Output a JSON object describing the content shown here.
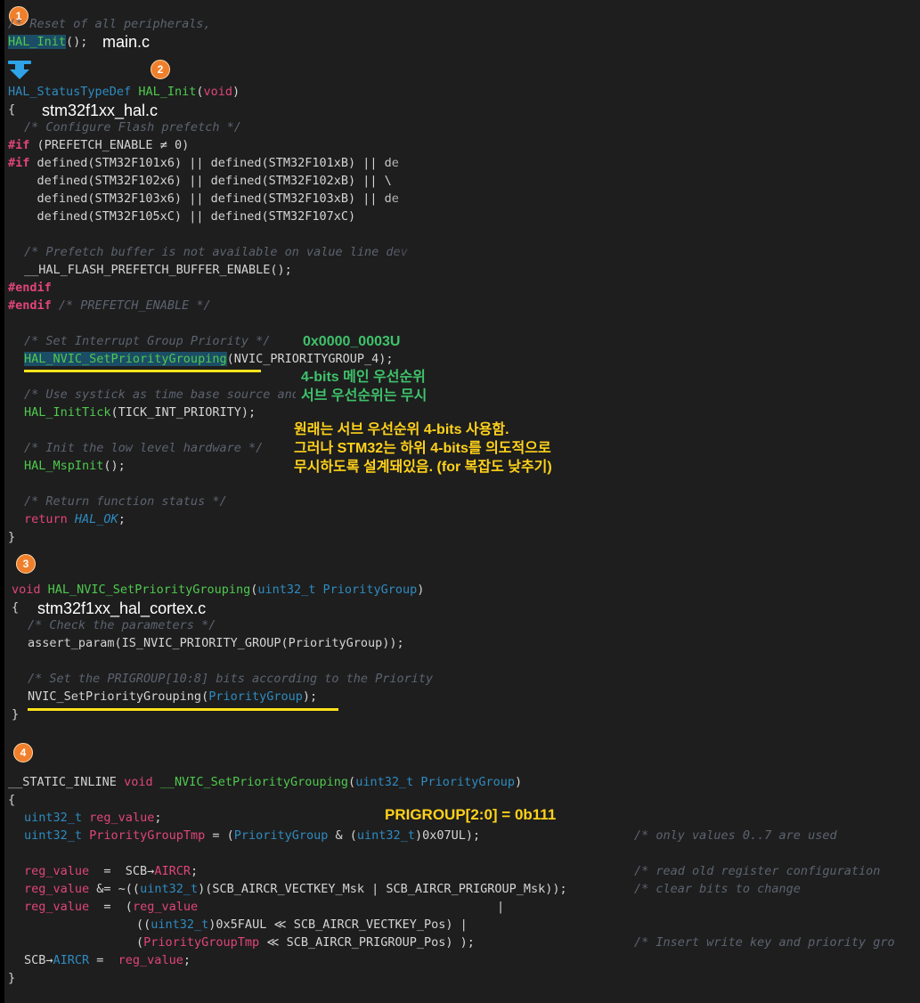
{
  "badges": [
    "1",
    "2",
    "3",
    "4"
  ],
  "files": {
    "main": "main.c",
    "hal": "stm32f1xx_hal.c",
    "cortex": "stm32f1xx_hal_cortex.c"
  },
  "annotations": {
    "group_value": "0x0000_0003U",
    "main_priority": "4-bits 메인 우선순위",
    "sub_priority": "서브 우선순위는 무시",
    "explain_1": "원래는 서브 우선순위 4-bits 사용함.",
    "explain_2": "그러나 STM32는 하위 4-bits를 의도적으로",
    "explain_3": "무시하도록 설계돼있음. (for 복잡도 낮추기)",
    "prigroup": "PRIGROUP[2:0] = 0b111"
  },
  "code": {
    "b1_comment": "/* Reset of all peripherals,",
    "hal_init_call": "HAL_Init",
    "hal_init_call_rest": "();",
    "hal_statustype": "HAL_StatusTypeDef",
    "hal_init_name": "HAL_Init",
    "void_kw": "void",
    "open_paren": "(",
    "close_paren": ")",
    "open_brace": "{",
    "close_brace": "}",
    "c_prefetch": "/* Configure Flash prefetch */",
    "if_kw": "#if",
    "if1_rest": " (PREFETCH_ENABLE ≠ 0)",
    "if2_rest": " defined(STM32F101x6) || defined(STM32F101xB) || de",
    "cont1": "    defined(STM32F102x6) || defined(STM32F102xB) || \\",
    "cont2": "    defined(STM32F103x6) || defined(STM32F103xB) || de",
    "cont3": "    defined(STM32F105xC) || defined(STM32F107xC)",
    "c_value_line": "/* Prefetch buffer is not available on value line dev",
    "flash_enable": "__HAL_FLASH_PREFETCH_BUFFER_ENABLE();",
    "endif_kw": "#endif",
    "c_prefetch_enable": "/* PREFETCH_ENABLE */",
    "c_group_prio": "/* Set Interrupt Group Priority */",
    "nvic_setgroup": "HAL_NVIC_SetPriorityGrouping",
    "nvic_setgroup_args": "(NVIC_PRIORITYGROUP_4);",
    "c_systick": "/* Use systick as time base source and configure",
    "inittick": "HAL_InitTick",
    "inittick_args": "(TICK_INT_PRIORITY);",
    "c_lowlevel": "/* Init the low level hardware */",
    "mspinit": "HAL_MspInit",
    "mspinit_args": "();",
    "c_return": "/* Return function status */",
    "return_kw": "return",
    "hal_ok": "HAL_OK",
    "semicolon": ";",
    "uint32_t": "uint32_t",
    "prioritygroup": "PriorityGroup",
    "c_check": "/* Check the parameters */",
    "assert_line": "assert_param(IS_NVIC_PRIORITY_GROUP(PriorityGroup));",
    "c_prigroup": "/* Set the PRIGROUP[10:8] bits according to the Priority",
    "nvic_call": "NVIC_SetPriorityGrouping(",
    "nvic_call_end": ");",
    "static_inline": "__STATIC_INLINE",
    "nvic_inner": "__NVIC_SetPriorityGrouping",
    "reg_value": "reg_value",
    "prioritygrouptmp": "PriorityGroupTmp",
    "tmp_assign": " = (",
    "tmp_and": " & (",
    "tmp_end": ")0x07UL);",
    "c_only_values": "/* only values 0..7 are used",
    "assign_eq": "  =  SCB→",
    "aircr": "AIRCR",
    "c_read_old": "/* read old register configuration",
    "and_eq": " &= ~((",
    "mask_rest": ")(SCB_AIRCR_VECTKEY_Msk | SCB_AIRCR_PRIGROUP_Msk));",
    "c_clear_bits": "/* clear bits to change",
    "assign_paren": "  =  (",
    "pipe": "|",
    "open_dparen": "((",
    "vectkey_rest": ")0x5FAUL ≪ SCB_AIRCR_VECTKEY_Pos) |",
    "prigroup_rest": " ≪ SCB_AIRCR_PRIGROUP_Pos) );",
    "c_insert": "/* Insert write key and priority gro",
    "scb_aircr": "SCB→",
    "aircr_assign": " =  "
  }
}
